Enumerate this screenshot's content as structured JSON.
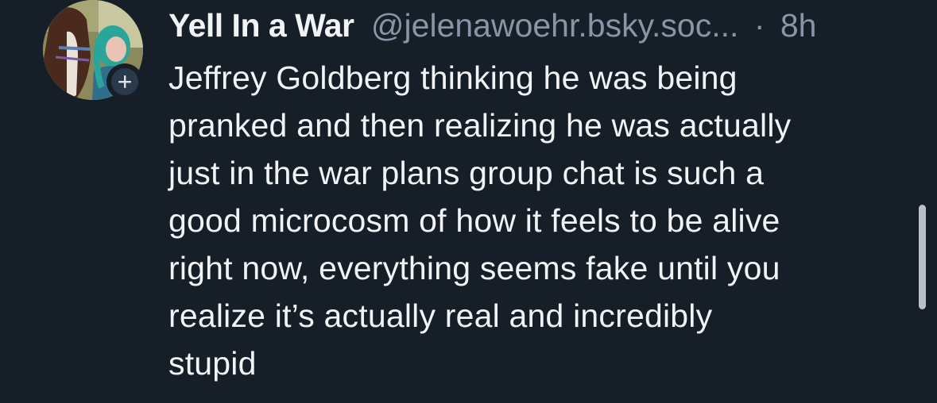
{
  "post": {
    "author": {
      "display_name": "Yell In a War",
      "handle": "@jelenawoehr.bsky.soc...",
      "avatar_icon": "profile-photo-with-horse",
      "follow_icon": "plus-icon"
    },
    "separator": "·",
    "timestamp": "8h",
    "text": "Jeffrey Goldberg thinking he was being\npranked and then realizing he was actually\njust in the war plans group chat is such a\ngood microcosm of how it feels to be alive\nright now, everything seems fake until you\nrealize it’s actually real and incredibly\nstupid"
  },
  "colors": {
    "background": "#161e27",
    "text_primary": "#f1f3f5",
    "text_secondary": "#8795a6",
    "follow_badge": "#2b3a4a",
    "scrollbar": "#b9c0c8"
  }
}
